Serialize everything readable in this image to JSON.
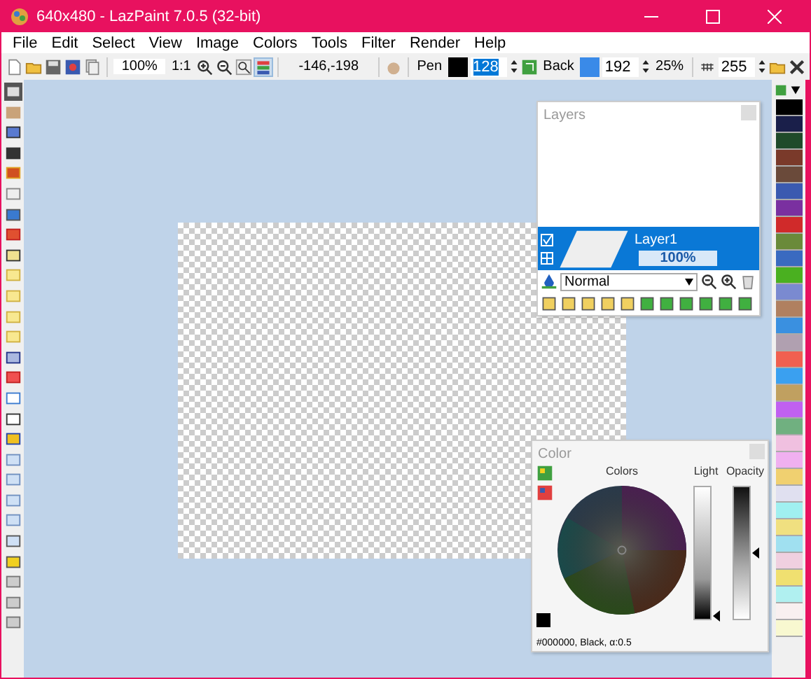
{
  "window": {
    "title": "640x480 - LazPaint 7.0.5 (32-bit)"
  },
  "menu": [
    "File",
    "Edit",
    "Select",
    "View",
    "Image",
    "Colors",
    "Tools",
    "Filter",
    "Render",
    "Help"
  ],
  "toolbar": {
    "zoom": "100%",
    "actual_size": "1:1",
    "coordinates": "-146,-198",
    "pen_label": "Pen",
    "pen_value": "128",
    "back_label": "Back",
    "back_value": "192",
    "tolerance": "25%",
    "alpha_value": "255"
  },
  "layers_panel": {
    "title": "Layers",
    "blend_mode": "Normal",
    "layers": [
      {
        "name": "Layer1",
        "opacity": "100%",
        "visible": true,
        "selected": true
      }
    ]
  },
  "color_panel": {
    "title": "Color",
    "colors_label": "Colors",
    "light_label": "Light",
    "opacity_label": "Opacity",
    "light_slider": {
      "level": 0.02
    },
    "opacity_slider": {
      "level": 0.5
    },
    "status": "#000000, Black, α:0.5"
  },
  "palette": [
    {
      "color": "#000000"
    },
    {
      "color": "#1a1f4a"
    },
    {
      "color": "#1f4a2a"
    },
    {
      "color": "#7a3a2a"
    },
    {
      "color": "#6a4a3a"
    },
    {
      "color": "#3a5ab0"
    },
    {
      "color": "#7a30a0"
    },
    {
      "color": "#d02a2a"
    },
    {
      "color": "#6a8a3a"
    },
    {
      "color": "#3a6ac0"
    },
    {
      "color": "#4ab020"
    },
    {
      "color": "#7a8ad0"
    },
    {
      "color": "#b08060"
    },
    {
      "color": "#3a90e0"
    },
    {
      "color": "#b0a0b0"
    },
    {
      "color": "#f06050"
    },
    {
      "color": "#3aa0f0"
    },
    {
      "color": "#c0a060"
    },
    {
      "color": "#c060f0"
    },
    {
      "color": "#70b080"
    },
    {
      "color": "#f0c0e0"
    },
    {
      "color": "#f0b0f0"
    },
    {
      "color": "#f0d070"
    },
    {
      "color": "#e0e0f0"
    },
    {
      "color": "#a0f0f0"
    },
    {
      "color": "#f0e080"
    },
    {
      "color": "#a0e0f0"
    },
    {
      "color": "#f0d0e0"
    },
    {
      "color": "#f0e070"
    },
    {
      "color": "#b0f0f0"
    },
    {
      "color": "#f8f0f0"
    },
    {
      "color": "#f8f8d0"
    }
  ]
}
